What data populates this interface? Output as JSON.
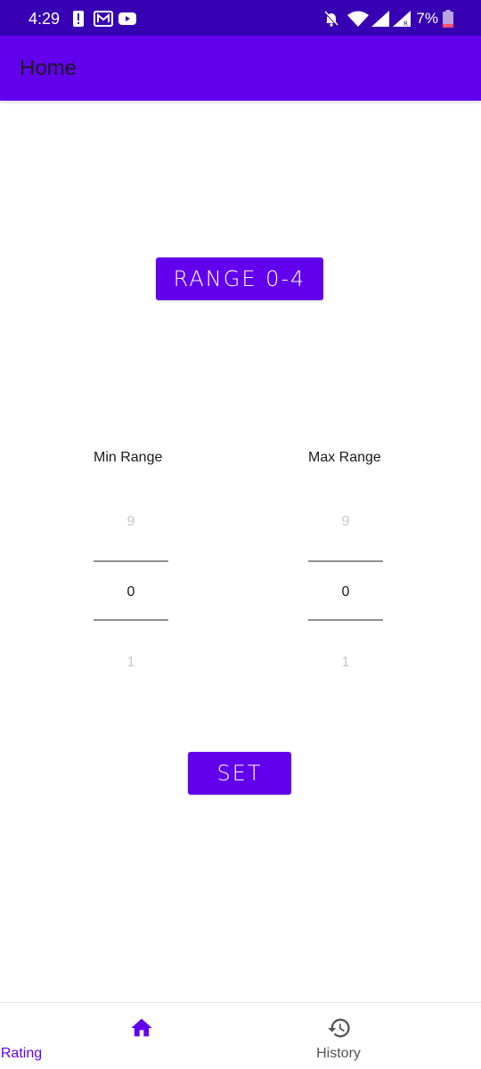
{
  "status_bar": {
    "time": "4:29",
    "battery_percent": "7%",
    "icons": [
      "alert-icon",
      "gmail-icon",
      "youtube-icon",
      "mute-icon",
      "wifi-icon",
      "signal-icon",
      "signal-roaming-icon",
      "battery-icon"
    ]
  },
  "app_bar": {
    "title": "Home"
  },
  "range_button": {
    "label": "RANGE 0-4"
  },
  "min_picker": {
    "label": "Min Range",
    "prev": "9",
    "current": "0",
    "next": "1"
  },
  "max_picker": {
    "label": "Max Range",
    "prev": "9",
    "current": "0",
    "next": "1"
  },
  "set_button": {
    "label": "SET"
  },
  "bottom_nav": {
    "items": [
      {
        "label": "Rating",
        "icon": "home-icon",
        "active": true
      },
      {
        "label": "History",
        "icon": "history-icon",
        "active": false
      }
    ]
  },
  "colors": {
    "primary": "#6200ee",
    "primary_dark": "#3700b3"
  }
}
